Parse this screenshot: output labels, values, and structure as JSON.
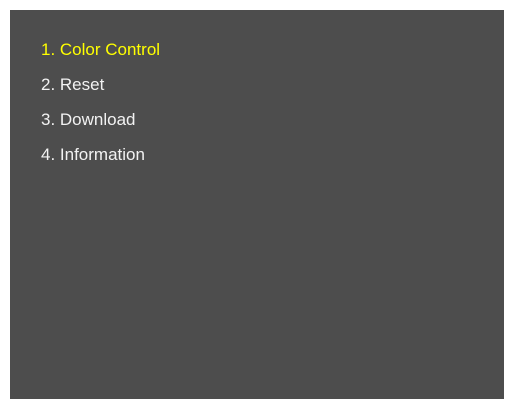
{
  "menu": {
    "items": [
      {
        "label": "1. Color Control",
        "selected": true
      },
      {
        "label": "2. Reset",
        "selected": false
      },
      {
        "label": "3. Download",
        "selected": false
      },
      {
        "label": "4. Information",
        "selected": false
      }
    ]
  },
  "colors": {
    "screen_background": "#4d4d4d",
    "item_text": "#f2f2f2",
    "selected_item_text": "#ffff00",
    "page_border": "#ffffff"
  }
}
